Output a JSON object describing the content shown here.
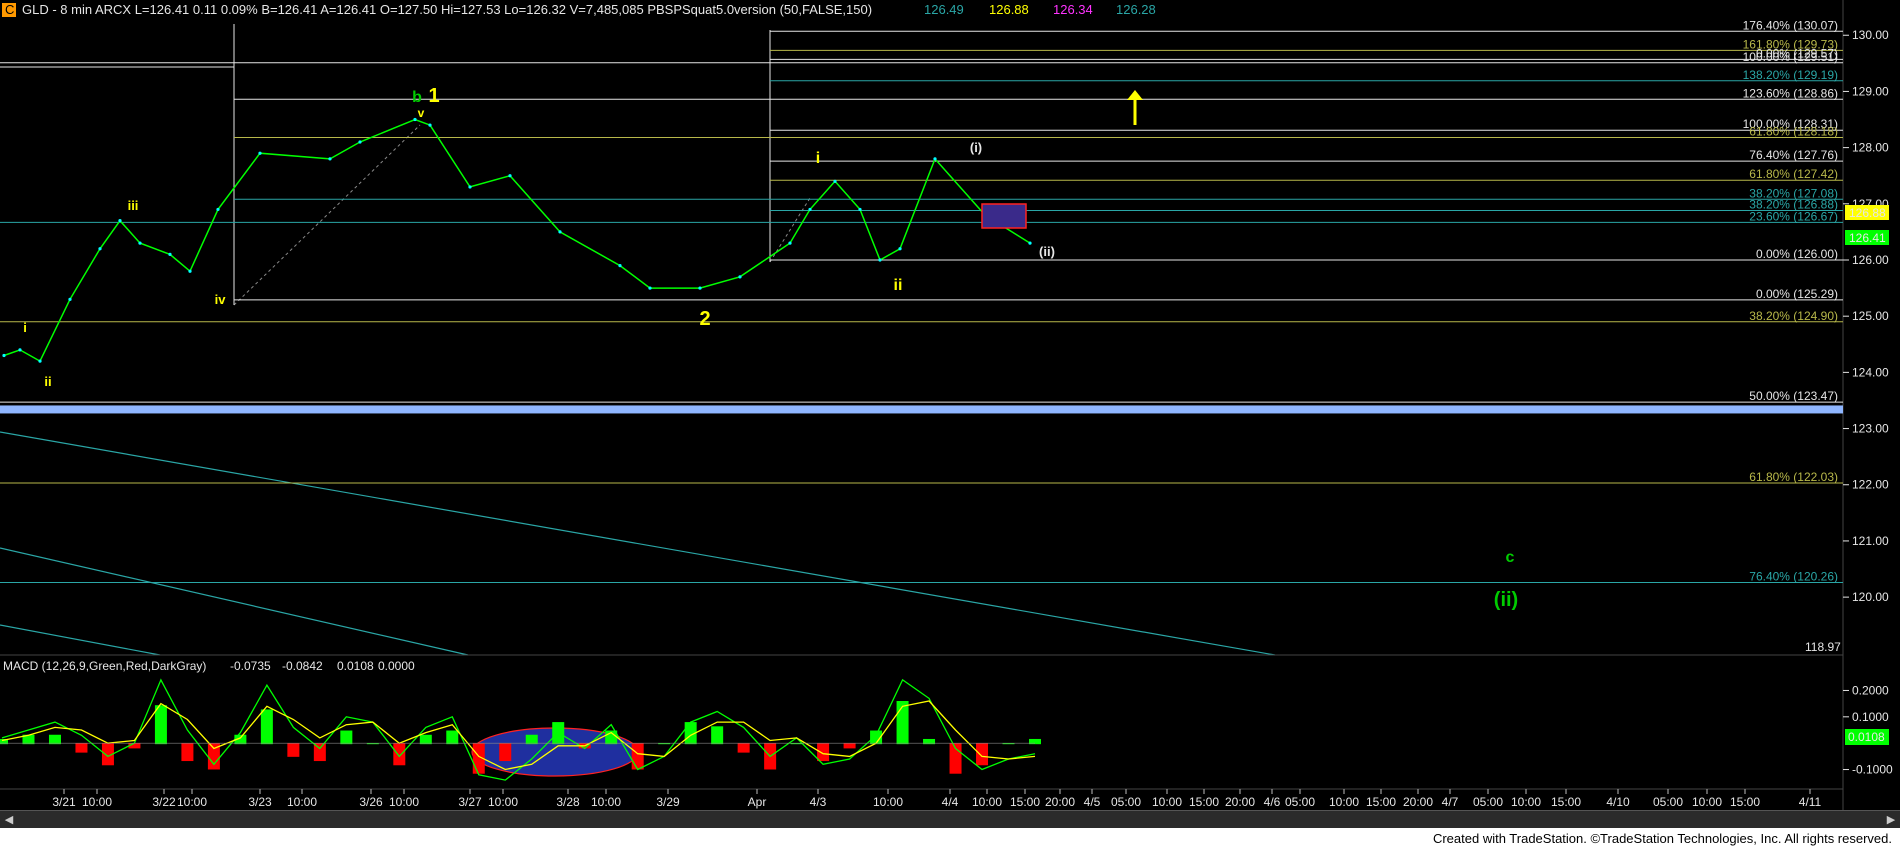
{
  "header": {
    "symbol_badge": "C",
    "title_text": "GLD - 8 min  ARCX  L=126.41  0.11  0.09%  B=126.41  A=126.41  O=127.50  Hi=127.53  Lo=126.32  V=7,485,085  PBSPSquat5.0version (50,FALSE,150)",
    "ind_values": [
      "126.49",
      "126.88",
      "126.34",
      "126.28"
    ]
  },
  "colors": {
    "background": "#000000",
    "price": "#00ff00",
    "wave_yellow": "#ffff00",
    "wave_green": "#00cc00",
    "fib_white": "#e6e6e6",
    "fib_olive": "#b8b84a",
    "fib_teal": "#2aa6a6",
    "blue_band": "#8fb6ff",
    "macd_hist_pos": "#00ff00",
    "macd_hist_neg": "#ff0000",
    "macd_line": "#00ff00",
    "signal_line": "#ffff00",
    "ellipse_fill": "#1f2f9f"
  },
  "chart_data": [
    {
      "type": "line",
      "title": "GLD - 8 min",
      "y_ticks": [
        "130.00",
        "129.00",
        "128.00",
        "127.00",
        "126.00",
        "125.00",
        "124.00",
        "123.00",
        "122.00",
        "121.00",
        "120.00"
      ],
      "ylim": [
        118.97,
        130.2
      ],
      "x_ticks": [
        "3/21",
        "10:00",
        "3/22",
        "10:00",
        "3/23",
        "10:00",
        "3/26",
        "10:00",
        "3/27",
        "10:00",
        "3/28",
        "10:00",
        "3/29",
        "Apr",
        "4/3",
        "10:00",
        "4/4",
        "10:00",
        "15:00",
        "20:00",
        "4/5",
        "05:00",
        "10:00",
        "15:00",
        "20:00",
        "4/6",
        "05:00",
        "10:00",
        "15:00",
        "20:00",
        "4/7",
        "05:00",
        "10:00",
        "15:00",
        "4/10",
        "05:00",
        "10:00",
        "15:00",
        "4/11"
      ],
      "axis_floor_label": "118.97",
      "price_series": [
        {
          "x": "3/21 start",
          "y": 124.3
        },
        {
          "x": "3/21",
          "y": 124.4
        },
        {
          "x": "3/21 mid",
          "y": 124.2
        },
        {
          "x": "3/21 10:00",
          "y": 125.3
        },
        {
          "x": "3/21 late",
          "y": 126.2
        },
        {
          "x": "3/22 open",
          "y": 126.7
        },
        {
          "x": "3/22",
          "y": 126.3
        },
        {
          "x": "3/22 10:00",
          "y": 126.1
        },
        {
          "x": "3/22 late",
          "y": 125.8
        },
        {
          "x": "3/23",
          "y": 126.9
        },
        {
          "x": "3/23 10:00",
          "y": 127.9
        },
        {
          "x": "3/23 late",
          "y": 127.8
        },
        {
          "x": "3/26",
          "y": 128.1
        },
        {
          "x": "3/26 10:00",
          "y": 128.5
        },
        {
          "x": "3/26 late",
          "y": 128.4
        },
        {
          "x": "3/27",
          "y": 127.3
        },
        {
          "x": "3/27 10:00",
          "y": 127.5
        },
        {
          "x": "3/27 late",
          "y": 126.5
        },
        {
          "x": "3/28",
          "y": 125.9
        },
        {
          "x": "3/28 10:00",
          "y": 125.5
        },
        {
          "x": "3/29",
          "y": 125.5
        },
        {
          "x": "3/29 late",
          "y": 125.7
        },
        {
          "x": "Apr",
          "y": 126.3
        },
        {
          "x": "Apr late",
          "y": 126.9
        },
        {
          "x": "4/3",
          "y": 127.4
        },
        {
          "x": "4/3 mid",
          "y": 126.9
        },
        {
          "x": "4/3 10:00",
          "y": 126.0
        },
        {
          "x": "4/3 late",
          "y": 126.2
        },
        {
          "x": "4/4",
          "y": 127.8
        },
        {
          "x": "4/4 10:00",
          "y": 126.8
        },
        {
          "x": "4/4 15:00",
          "y": 126.3
        }
      ],
      "fib_levels": [
        {
          "label": "176.40% (130.07)",
          "value": 130.07,
          "color": "#e6e6e6"
        },
        {
          "label": "100.00% (129.51)",
          "value": 129.51,
          "color": "#e6e6e6"
        },
        {
          "label": "161.80% (129.73)",
          "value": 129.73,
          "color": "#b8b84a"
        },
        {
          "label": "0.00% (129.57)",
          "value": 129.57,
          "color": "#e6e6e6"
        },
        {
          "label": "138.20% (129.19)",
          "value": 129.19,
          "color": "#2aa6a6"
        },
        {
          "label": "123.60% (128.86)",
          "value": 128.86,
          "color": "#e6e6e6"
        },
        {
          "label": "100.00% (128.31)",
          "value": 128.31,
          "color": "#e6e6e6"
        },
        {
          "label": "61.80% (128.18)",
          "value": 128.18,
          "color": "#b8b84a"
        },
        {
          "label": "76.40% (127.76)",
          "value": 127.76,
          "color": "#e6e6e6"
        },
        {
          "label": "61.80% (127.42)",
          "value": 127.42,
          "color": "#b8b84a"
        },
        {
          "label": "38.20% (127.08)",
          "value": 127.08,
          "color": "#2aa6a6"
        },
        {
          "label": "38.20% (126.88)",
          "value": 126.88,
          "color": "#2aa6a6"
        },
        {
          "label": "23.60% (126.67)",
          "value": 126.67,
          "color": "#2aa6a6"
        },
        {
          "label": "0.00% (126.00)",
          "value": 126.0,
          "color": "#e6e6e6"
        },
        {
          "label": "0.00% (125.29)",
          "value": 125.29,
          "color": "#e6e6e6"
        },
        {
          "label": "38.20% (124.90)",
          "value": 124.9,
          "color": "#b8b84a"
        },
        {
          "label": "50.00% (123.47)",
          "value": 123.47,
          "color": "#e6e6e6"
        },
        {
          "label": "61.80% (122.03)",
          "value": 122.03,
          "color": "#b8b84a"
        },
        {
          "label": "76.40% (120.26)",
          "value": 120.26,
          "color": "#2aa6a6"
        }
      ],
      "blue_band_value": 123.34,
      "price_tags": [
        {
          "label": "126.88",
          "bg": "#ffff00",
          "fg": "#000000"
        },
        {
          "label": "126.41",
          "bg": "#00ff00",
          "fg": "#000000"
        }
      ],
      "wave_labels": [
        {
          "text": "i",
          "color": "#ffff00"
        },
        {
          "text": "ii",
          "color": "#ffff00"
        },
        {
          "text": "iii",
          "color": "#ffff00"
        },
        {
          "text": "iv",
          "color": "#ffff00"
        },
        {
          "text": "v",
          "color": "#ffff00"
        },
        {
          "text": "b",
          "color": "#00cc00"
        },
        {
          "text": "1",
          "color": "#ffff00"
        },
        {
          "text": "2",
          "color": "#ffff00"
        },
        {
          "text": "i",
          "color": "#ffff00"
        },
        {
          "text": "ii",
          "color": "#ffff00"
        },
        {
          "text": "(i)",
          "color": "#e6e6e6"
        },
        {
          "text": "(ii)",
          "color": "#e6e6e6"
        },
        {
          "text": "c",
          "color": "#00cc00"
        },
        {
          "text": "(ii)",
          "color": "#00cc00"
        }
      ]
    },
    {
      "type": "line",
      "title": "MACD (12,26,9,Green,Red,DarkGray)",
      "values_text": [
        "-0.0735",
        "-0.0842",
        "0.0108",
        "0.0000"
      ],
      "y_ticks": [
        "0.2000",
        "0.1000",
        "-0.1000"
      ],
      "ylim": [
        -0.17,
        0.27
      ],
      "last_value_tag": "0.0108",
      "series": [
        {
          "name": "MACD",
          "values": [
            0.02,
            0.05,
            0.08,
            0.03,
            -0.05,
            0.0,
            0.24,
            0.05,
            -0.08,
            0.04,
            0.22,
            0.06,
            -0.02,
            0.1,
            0.08,
            -0.05,
            0.06,
            0.1,
            -0.12,
            -0.14,
            -0.06,
            0.04,
            -0.02,
            0.07,
            -0.1,
            -0.05,
            0.08,
            0.12,
            0.06,
            -0.05,
            0.02,
            -0.08,
            -0.06,
            0.03,
            0.24,
            0.17,
            -0.02,
            -0.1,
            -0.06,
            -0.04
          ]
        },
        {
          "name": "Signal",
          "values": [
            0.01,
            0.03,
            0.06,
            0.05,
            0.0,
            0.01,
            0.15,
            0.09,
            -0.02,
            0.02,
            0.14,
            0.09,
            0.02,
            0.07,
            0.08,
            0.0,
            0.04,
            0.07,
            -0.05,
            -0.1,
            -0.08,
            -0.01,
            -0.01,
            0.04,
            -0.04,
            -0.05,
            0.03,
            0.08,
            0.08,
            0.01,
            0.02,
            -0.04,
            -0.05,
            0.0,
            0.14,
            0.16,
            0.05,
            -0.05,
            -0.06,
            -0.05
          ]
        }
      ]
    }
  ],
  "footer": {
    "credit": "Created with TradeStation. ©TradeStation Technologies, Inc. All rights reserved."
  }
}
